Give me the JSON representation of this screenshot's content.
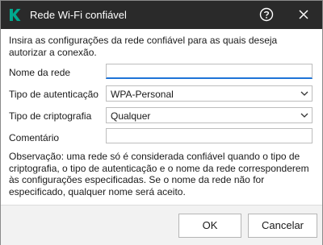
{
  "window": {
    "title": "Rede Wi-Fi confiável",
    "logo_icon": "kaspersky-logo",
    "accent": "#1e74d7"
  },
  "intro": "Insira as configurações da rede confiável para as quais deseja autorizar a conexão.",
  "form": {
    "network_name": {
      "label": "Nome da rede",
      "value": "",
      "placeholder": ""
    },
    "auth_type": {
      "label": "Tipo de autenticação",
      "value": "WPA-Personal"
    },
    "encryption_type": {
      "label": "Tipo de criptografia",
      "value": "Qualquer"
    },
    "comment": {
      "label": "Comentário",
      "value": "",
      "placeholder": ""
    }
  },
  "note": "Observação: uma rede só é considerada confiável quando o tipo de criptografia, o tipo de autenticação e o nome da rede corresponderem às configurações especificadas. Se o nome da rede não for especificado, qualquer nome será aceito.",
  "buttons": {
    "ok": "OK",
    "cancel": "Cancelar"
  }
}
